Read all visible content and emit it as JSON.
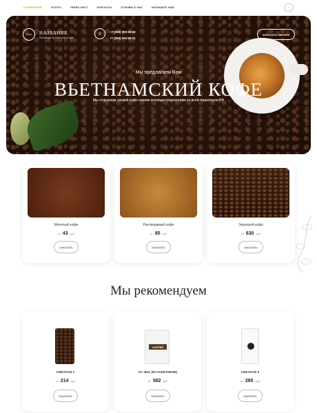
{
  "nav": {
    "items": [
      "О КОМПАНИИ",
      "УСЛУГИ",
      "ПРАЙС-ЛИСТ",
      "КОНТАКТЫ",
      "ОТЗЫВЫ О НАС",
      "НАПИШИТЕ НАМ"
    ],
    "active_index": 0,
    "menu_icon": "more-icon"
  },
  "header": {
    "logo_text": "LOGO",
    "brand_name": "НАЗВАНИЕ",
    "brand_sub": "Поставщик лучшего сорта кофе",
    "phone_icon": "phone-icon",
    "phone_1": "+7 (000) 000-00-00",
    "phone_2": "+7 (000) 000-00-01",
    "call_button": "ЗАКАЗАТЬ ЗВОНОК"
  },
  "hero": {
    "pretitle": "Мы предлагаем Вам",
    "title": "ВЬЕТНАМСКИЙ КОФЕ",
    "subtitle": "Мы отгружаем свежий кофе нашим оптовым покупателям по всей территории РФ"
  },
  "products": [
    {
      "name": "Молотый кофе",
      "price_prefix": "от",
      "price": "43",
      "currency": "руб",
      "button": "ЗАКАЗАТЬ"
    },
    {
      "name": "Растворимый кофе",
      "price_prefix": "от",
      "price": "85",
      "currency": "руб",
      "button": "ЗАКАЗАТЬ"
    },
    {
      "name": "Зерновой кофе",
      "price_prefix": "от",
      "price": "630",
      "currency": "руб",
      "button": "ЗАКАЗАТЬ"
    }
  ],
  "recommend": {
    "title": "Мы рекомендуем",
    "items": [
      {
        "name": "CREATIVE 1",
        "price_prefix": "от",
        "price": "214",
        "currency": "руб",
        "button": "ЗАКАЗАТЬ"
      },
      {
        "name": "G7 3IN1 (50 ПАКЕТИКОВ)",
        "price_prefix": "от",
        "price": "582",
        "currency": "руб",
        "button": "ЗАКАЗАТЬ",
        "pack_label": "COFFEE"
      },
      {
        "name": "CREATIVE 3",
        "price_prefix": "от",
        "price": "285",
        "currency": "руб",
        "button": "ЗАКАЗАТЬ"
      }
    ]
  },
  "colors": {
    "accent": "#d59a1f",
    "text": "#222222"
  }
}
